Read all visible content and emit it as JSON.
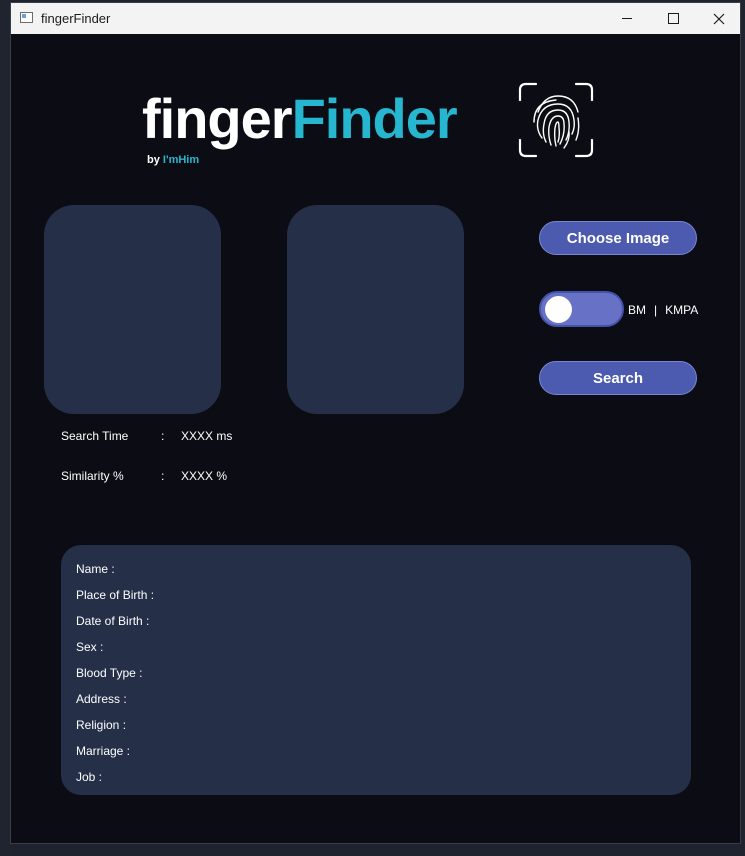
{
  "window": {
    "title": "fingerFinder"
  },
  "header": {
    "logo_part1": "finger",
    "logo_part2": "Finder",
    "byline_prefix": "by",
    "byline_brand": "I'mHim"
  },
  "controls": {
    "choose_label": "Choose Image",
    "search_label": "Search",
    "toggle_left_label": "BM",
    "toggle_separator": "|",
    "toggle_right_label": "KMPA",
    "toggle_state": "BM"
  },
  "stats": {
    "search_time_label": "Search Time",
    "search_time_value": "XXXX ms",
    "similarity_label": "Similarity %",
    "similarity_value": "XXXX %",
    "colon": ":"
  },
  "bio": {
    "fields": [
      "Name :",
      "Place of Birth :",
      "Date of Birth :",
      "Sex :",
      "Blood Type :",
      "Address :",
      "Religion :",
      "Marriage :",
      "Job :"
    ]
  },
  "colors": {
    "accent": "#26b6cf",
    "button": "#4c5ab0",
    "panel": "#252f48",
    "background": "#0c0d14"
  },
  "icons": {
    "logo": "fingerprint-scan-icon",
    "app": "window-app-icon"
  }
}
